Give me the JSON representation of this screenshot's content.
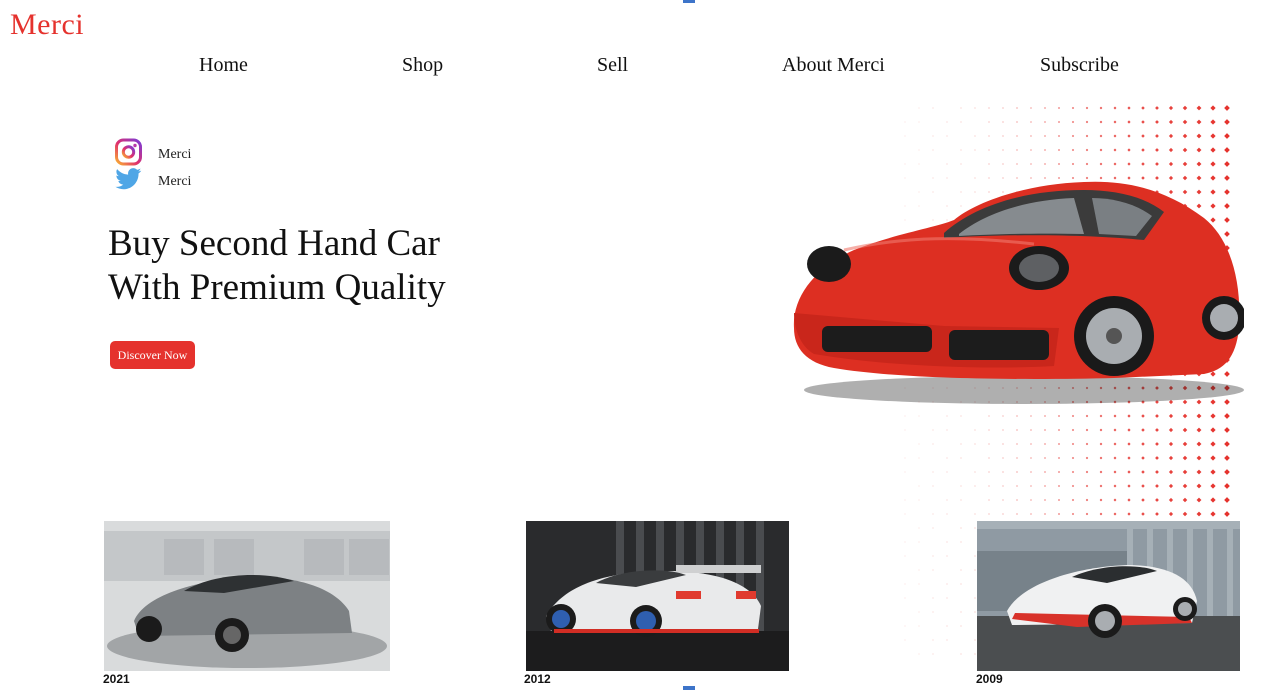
{
  "brand": {
    "name": "Merci",
    "color": "#e5322d"
  },
  "nav": {
    "items": [
      {
        "label": "Home"
      },
      {
        "label": "Shop"
      },
      {
        "label": "Sell"
      },
      {
        "label": "About Merci"
      },
      {
        "label": "Subscribe"
      }
    ]
  },
  "social": {
    "instagram": {
      "icon": "instagram-icon",
      "label": "Merci"
    },
    "twitter": {
      "icon": "twitter-icon",
      "label": "Merci"
    }
  },
  "hero": {
    "title_line1": "Buy Second Hand Car",
    "title_line2": "With Premium Quality",
    "cta_label": "Discover Now",
    "image": "red-porsche-911-image"
  },
  "cars": [
    {
      "year": "2021",
      "image": "grey-toyota-supra-image"
    },
    {
      "year": "2012",
      "image": "white-race-coupe-image"
    },
    {
      "year": "2009",
      "image": "white-nissan-370z-nismo-image"
    }
  ]
}
